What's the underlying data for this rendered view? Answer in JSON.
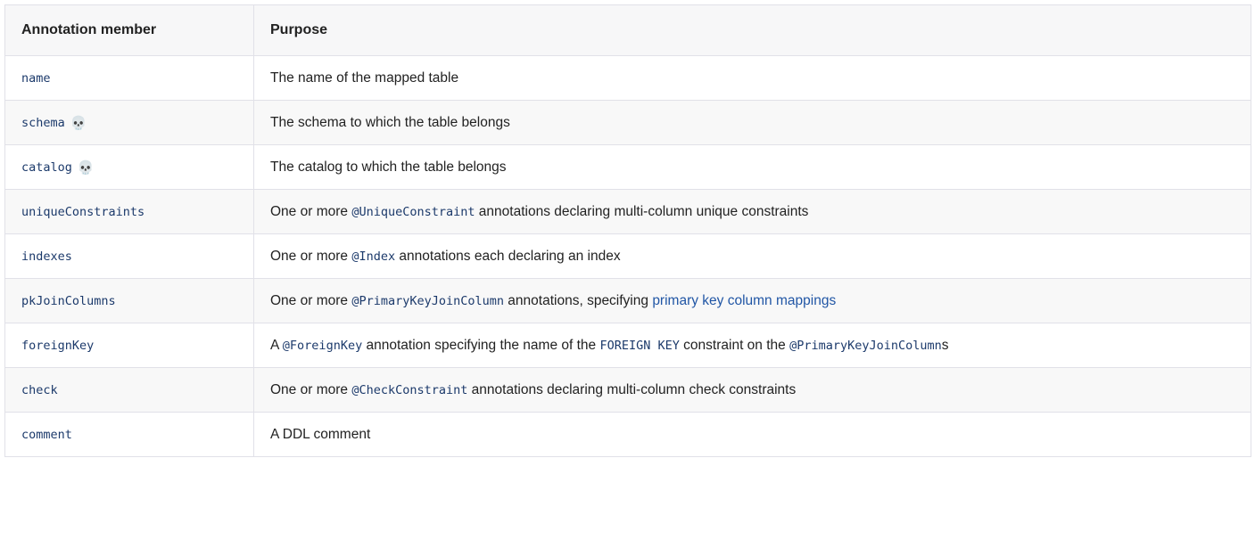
{
  "table": {
    "headers": [
      "Annotation member",
      "Purpose"
    ],
    "rows": [
      {
        "member": "name",
        "icon": null,
        "purpose": [
          {
            "t": "text",
            "v": "The name of the mapped table"
          }
        ]
      },
      {
        "member": "schema",
        "icon": "skull-icon",
        "icon_glyph": "💀",
        "purpose": [
          {
            "t": "text",
            "v": "The schema to which the table belongs"
          }
        ]
      },
      {
        "member": "catalog",
        "icon": "skull-icon",
        "icon_glyph": "💀",
        "purpose": [
          {
            "t": "text",
            "v": "The catalog to which the table belongs"
          }
        ]
      },
      {
        "member": "uniqueConstraints",
        "icon": null,
        "purpose": [
          {
            "t": "text",
            "v": "One or more "
          },
          {
            "t": "code",
            "v": "@UniqueConstraint"
          },
          {
            "t": "text",
            "v": " annotations declaring multi-column unique constraints"
          }
        ]
      },
      {
        "member": "indexes",
        "icon": null,
        "purpose": [
          {
            "t": "text",
            "v": "One or more "
          },
          {
            "t": "code",
            "v": "@Index"
          },
          {
            "t": "text",
            "v": " annotations each declaring an index"
          }
        ]
      },
      {
        "member": "pkJoinColumns",
        "icon": null,
        "purpose": [
          {
            "t": "text",
            "v": "One or more "
          },
          {
            "t": "code",
            "v": "@PrimaryKeyJoinColumn"
          },
          {
            "t": "text",
            "v": " annotations, specifying "
          },
          {
            "t": "link",
            "v": "primary key column mappings"
          }
        ]
      },
      {
        "member": "foreignKey",
        "icon": null,
        "purpose": [
          {
            "t": "text",
            "v": "A "
          },
          {
            "t": "code",
            "v": "@ForeignKey"
          },
          {
            "t": "text",
            "v": " annotation specifying the name of the "
          },
          {
            "t": "code",
            "v": "FOREIGN KEY"
          },
          {
            "t": "text",
            "v": " constraint on the "
          },
          {
            "t": "code",
            "v": "@PrimaryKeyJoinColumn"
          },
          {
            "t": "text",
            "v": "s"
          }
        ]
      },
      {
        "member": "check",
        "icon": null,
        "purpose": [
          {
            "t": "text",
            "v": "One or more "
          },
          {
            "t": "code",
            "v": "@CheckConstraint"
          },
          {
            "t": "text",
            "v": " annotations declaring multi-column check constraints"
          }
        ]
      },
      {
        "member": "comment",
        "icon": null,
        "purpose": [
          {
            "t": "text",
            "v": "A DDL comment"
          }
        ]
      }
    ]
  }
}
